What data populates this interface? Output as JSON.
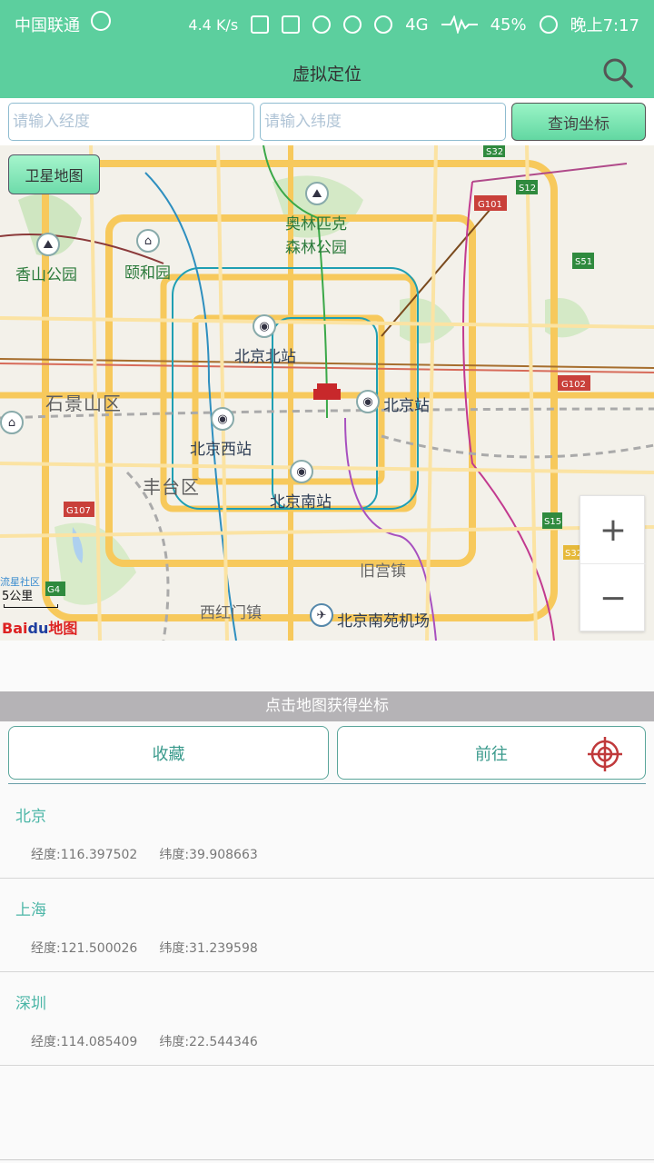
{
  "status_bar": {
    "carrier": "中国联通",
    "net_speed": "4.4 K/s",
    "network": "4G",
    "battery": "45%",
    "time": "晚上7:17"
  },
  "app_bar": {
    "title": "虚拟定位",
    "search_icon": "search-icon"
  },
  "query": {
    "longitude_placeholder": "请输入经度",
    "latitude_placeholder": "请输入纬度",
    "longitude_value": "",
    "latitude_value": "",
    "button_label": "查询坐标"
  },
  "map": {
    "satellite_button": "卫星地图",
    "zoom_in": "+",
    "zoom_out": "−",
    "scale": "5公里",
    "scale_corner_label": "流星社区",
    "logo_bai": "Bai",
    "logo_du": "du",
    "logo_suffix": "地图",
    "labels": {
      "xiangshan": "香山公园",
      "yiheyuan": "颐和园",
      "olympic_1": "奥林匹克",
      "olympic_2": "森林公园",
      "beijing_north": "北京北站",
      "shijingshan": "石景山区",
      "beijing_station": "北京站",
      "beijing_west": "北京西站",
      "fengtai": "丰台区",
      "beijing_south": "北京南站",
      "jiugongzhen": "旧宫镇",
      "xihongmen": "西红门镇",
      "nanyuan_airport": "北京南苑机场"
    },
    "road_shields": {
      "s12": "S12",
      "g101": "G101",
      "s51": "S51",
      "g102": "G102",
      "g107": "G107",
      "s15": "S15",
      "g4": "G4",
      "s32": "S32",
      "s32b": "S32"
    }
  },
  "hint": "点击地图获得坐标",
  "actions": {
    "favorite": "收藏",
    "go": "前往"
  },
  "locations": [
    {
      "name": "北京",
      "lng_label": "经度:116.397502",
      "lat_label": "纬度:39.908663"
    },
    {
      "name": "上海",
      "lng_label": "经度:121.500026",
      "lat_label": "纬度:31.239598"
    },
    {
      "name": "深圳",
      "lng_label": "经度:114.085409",
      "lat_label": "纬度:22.544346"
    }
  ],
  "colors": {
    "accent": "#5ccf9e",
    "list_name": "#4cb6a7",
    "target_icon": "#c0393b"
  }
}
